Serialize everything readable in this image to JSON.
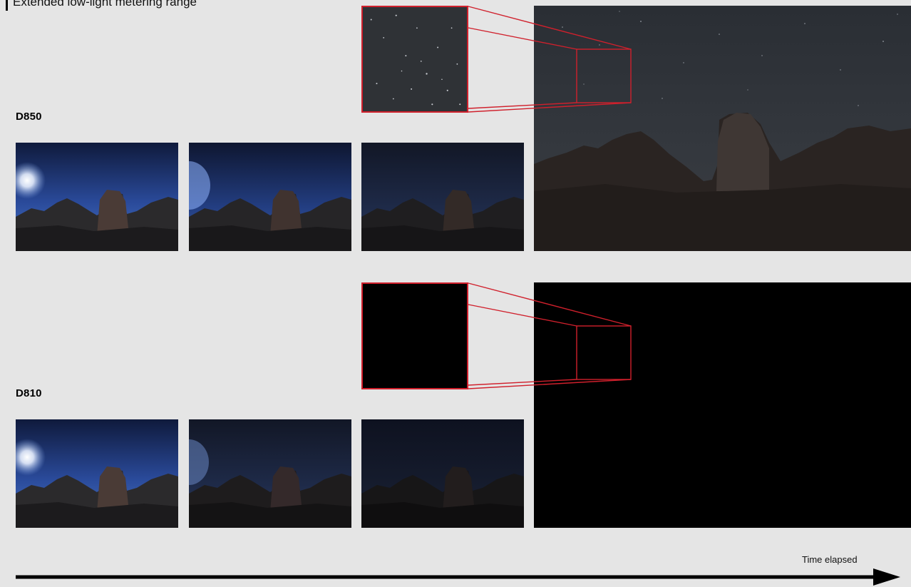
{
  "title": "Extended low-light metering range",
  "cameras": [
    {
      "label": "D850",
      "zoom_stars": true
    },
    {
      "label": "D810",
      "zoom_stars": false
    }
  ],
  "time_label": "Time elapsed",
  "colors": {
    "background": "#e5e5e5",
    "highlight": "#d0202c",
    "arrow": "#000000"
  }
}
